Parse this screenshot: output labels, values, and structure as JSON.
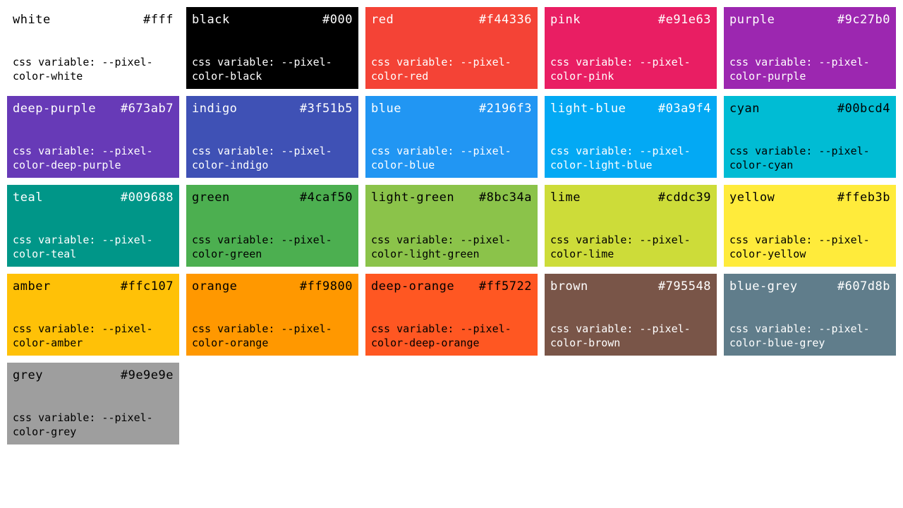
{
  "var_prefix": "css variable: --pixel-",
  "colors": [
    {
      "name": "white",
      "hex": "#fff",
      "var": "color-white",
      "bg": "#ffffff",
      "fg": "#000000"
    },
    {
      "name": "black",
      "hex": "#000",
      "var": "color-black",
      "bg": "#000000",
      "fg": "#ffffff"
    },
    {
      "name": "red",
      "hex": "#f44336",
      "var": "color-red",
      "bg": "#f44336",
      "fg": "#ffffff"
    },
    {
      "name": "pink",
      "hex": "#e91e63",
      "var": "color-pink",
      "bg": "#e91e63",
      "fg": "#ffffff"
    },
    {
      "name": "purple",
      "hex": "#9c27b0",
      "var": "color-purple",
      "bg": "#9c27b0",
      "fg": "#ffffff"
    },
    {
      "name": "deep-purple",
      "hex": "#673ab7",
      "var": "color-deep-purple",
      "bg": "#673ab7",
      "fg": "#ffffff"
    },
    {
      "name": "indigo",
      "hex": "#3f51b5",
      "var": "color-indigo",
      "bg": "#3f51b5",
      "fg": "#ffffff"
    },
    {
      "name": "blue",
      "hex": "#2196f3",
      "var": "color-blue",
      "bg": "#2196f3",
      "fg": "#ffffff"
    },
    {
      "name": "light-blue",
      "hex": "#03a9f4",
      "var": "color-light-blue",
      "bg": "#03a9f4",
      "fg": "#ffffff"
    },
    {
      "name": "cyan",
      "hex": "#00bcd4",
      "var": "color-cyan",
      "bg": "#00bcd4",
      "fg": "#000000"
    },
    {
      "name": "teal",
      "hex": "#009688",
      "var": "color-teal",
      "bg": "#009688",
      "fg": "#ffffff"
    },
    {
      "name": "green",
      "hex": "#4caf50",
      "var": "color-green",
      "bg": "#4caf50",
      "fg": "#000000"
    },
    {
      "name": "light-green",
      "hex": "#8bc34a",
      "var": "color-light-green",
      "bg": "#8bc34a",
      "fg": "#000000"
    },
    {
      "name": "lime",
      "hex": "#cddc39",
      "var": "color-lime",
      "bg": "#cddc39",
      "fg": "#000000"
    },
    {
      "name": "yellow",
      "hex": "#ffeb3b",
      "var": "color-yellow",
      "bg": "#ffeb3b",
      "fg": "#000000"
    },
    {
      "name": "amber",
      "hex": "#ffc107",
      "var": "color-amber",
      "bg": "#ffc107",
      "fg": "#000000"
    },
    {
      "name": "orange",
      "hex": "#ff9800",
      "var": "color-orange",
      "bg": "#ff9800",
      "fg": "#000000"
    },
    {
      "name": "deep-orange",
      "hex": "#ff5722",
      "var": "color-deep-orange",
      "bg": "#ff5722",
      "fg": "#000000"
    },
    {
      "name": "brown",
      "hex": "#795548",
      "var": "color-brown",
      "bg": "#795548",
      "fg": "#ffffff"
    },
    {
      "name": "blue-grey",
      "hex": "#607d8b",
      "var": "color-blue-grey",
      "bg": "#607d8b",
      "fg": "#ffffff"
    },
    {
      "name": "grey",
      "hex": "#9e9e9e",
      "var": "color-grey",
      "bg": "#9e9e9e",
      "fg": "#000000"
    }
  ]
}
